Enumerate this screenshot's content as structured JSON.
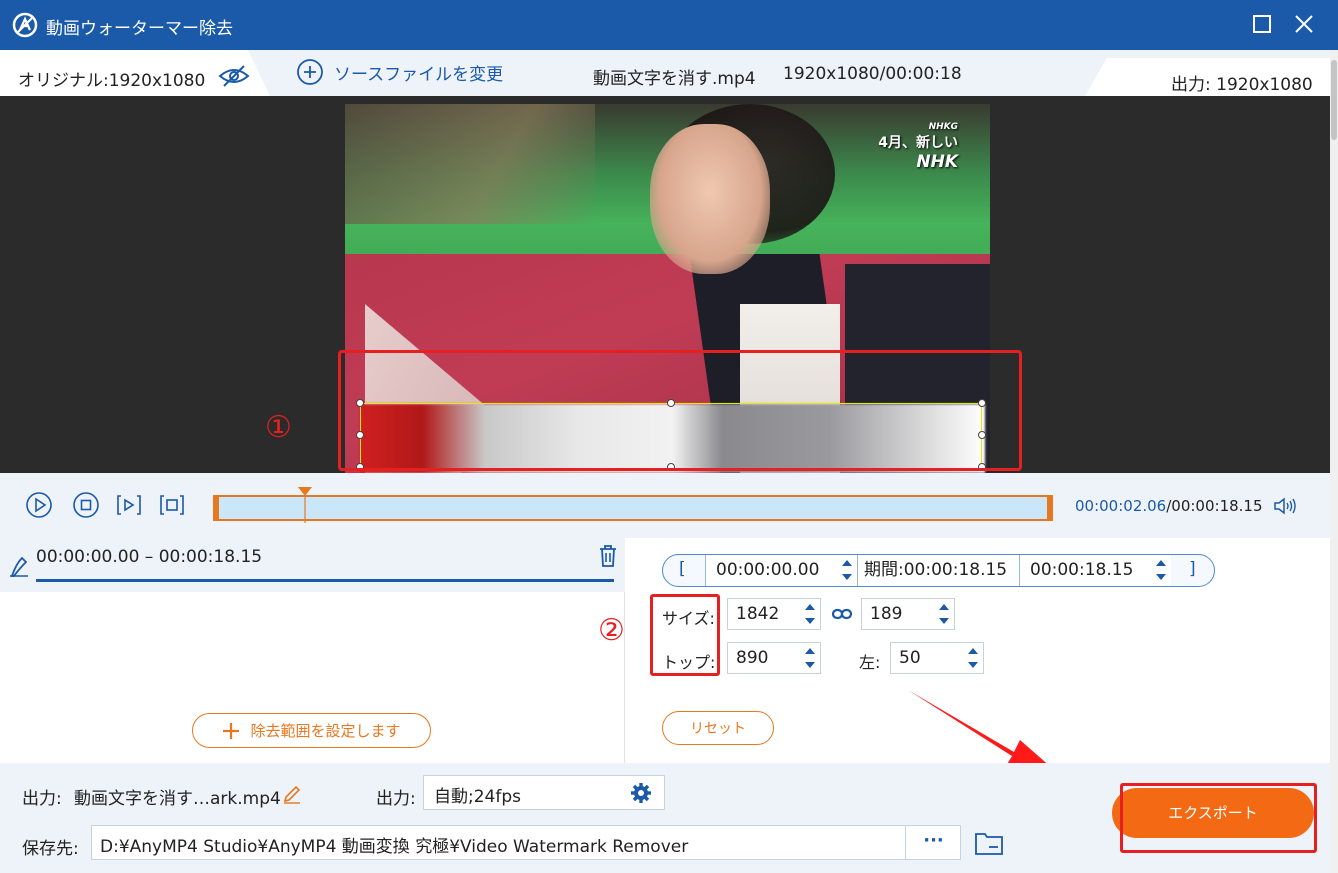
{
  "app": {
    "title": "動画ウォーターマー除去",
    "colors": {
      "titlebar": "#1a5aa8",
      "accent": "#f46a14",
      "blue": "#1a5aa8",
      "annotation": "#e62020"
    }
  },
  "infobar": {
    "original": "オリジナル:1920x1080",
    "change_source": "ソースファイルを変更",
    "filename": "動画文字を消す.mp4",
    "resolution_duration": "1920x1080/00:00:18",
    "output": "出力: 1920x1080"
  },
  "video": {
    "logo_small": "NHKG",
    "logo_text": "4月、新しい",
    "logo_big": "NHK"
  },
  "annotations": {
    "one": "①",
    "two": "②"
  },
  "playback": {
    "current_time": "00:00:02.06",
    "total_time": "/00:00:18.15",
    "progress": 0.11
  },
  "range_list": {
    "item": "00:00:00.00 – 00:00:18.15",
    "add_button": "除去範囲を設定します"
  },
  "settings": {
    "bracket_left": "[",
    "bracket_right": "]",
    "start_time": "00:00:00.00",
    "duration": "期間:00:00:18.15",
    "end_time": "00:00:18.15",
    "size_label": "サイズ:",
    "width": "1842",
    "height": "189",
    "top_label": "トップ:",
    "top": "890",
    "left_label": "左:",
    "left": "50",
    "reset": "リセット"
  },
  "bottom": {
    "output_label": "出力:",
    "output_name": "動画文字を消す…ark.mp4",
    "format_label": "出力:",
    "format_value": "自動;24fps",
    "save_label": "保存先:",
    "save_path": "D:¥AnyMP4 Studio¥AnyMP4 動画変換 究極¥Video Watermark Remover",
    "browse": "···",
    "export": "エクスポート"
  }
}
